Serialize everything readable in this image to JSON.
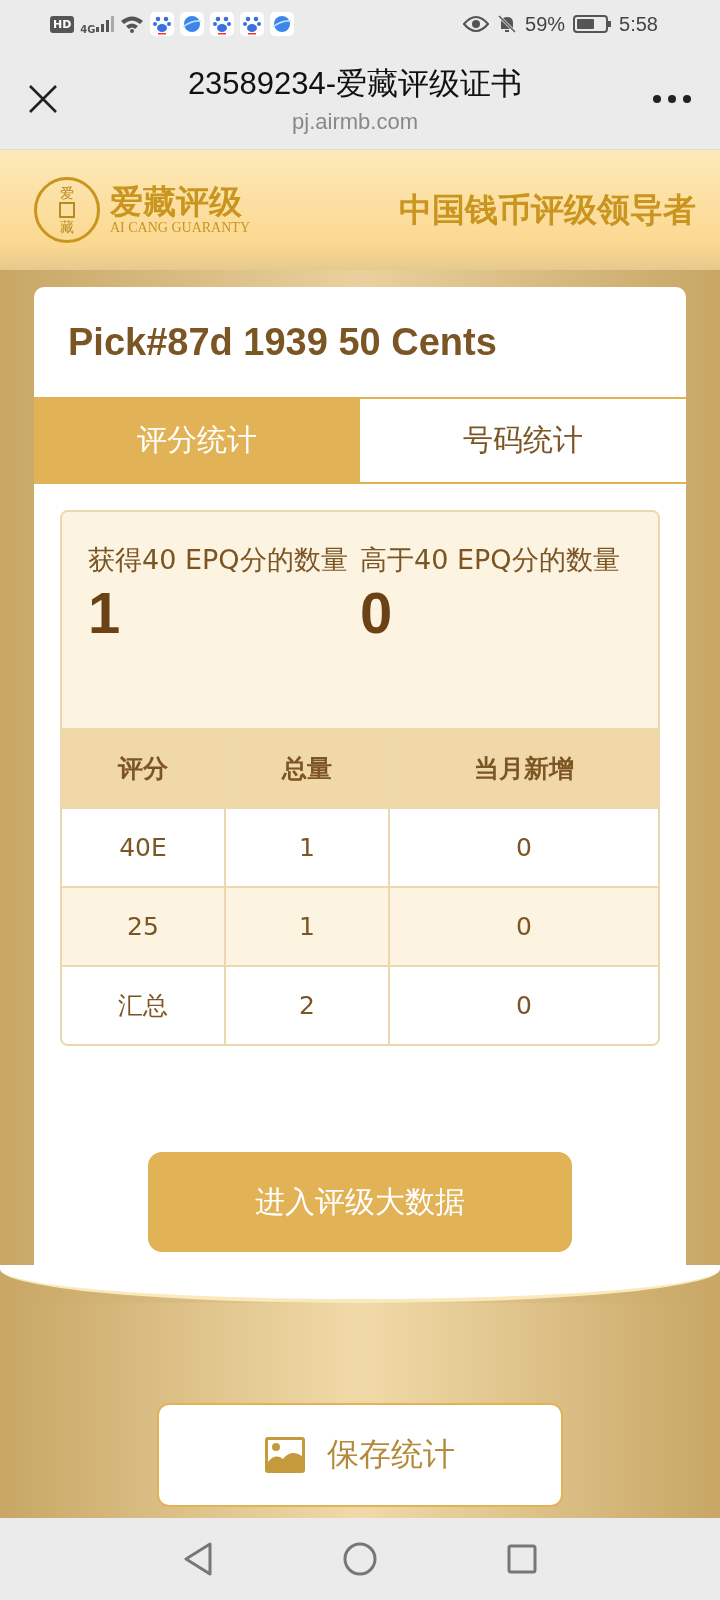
{
  "status_bar": {
    "hd": "HD",
    "network": "4G",
    "app_icons": [
      {
        "kind": "paw"
      },
      {
        "kind": "globe"
      },
      {
        "kind": "paw"
      },
      {
        "kind": "paw"
      },
      {
        "kind": "globe"
      }
    ],
    "battery": "59%",
    "time": "5:58"
  },
  "browser": {
    "title": "23589234-爱藏评级证书",
    "url": "pj.airmb.com"
  },
  "banner": {
    "coin_top": "爱",
    "coin_bottom": "藏",
    "brand": "爱藏评级",
    "brand_en": "AI CANG GUARANTY",
    "slogan": "中国钱币评级领导者"
  },
  "card": {
    "title": "Pick#87d 1939 50 Cents"
  },
  "tabs": [
    {
      "label": "评分统计",
      "selected": true
    },
    {
      "label": "号码统计",
      "selected": false
    }
  ],
  "stats": [
    {
      "label": "获得40 EPQ分的数量",
      "value": "1"
    },
    {
      "label": "高于40 EPQ分的数量",
      "value": "0"
    }
  ],
  "table": {
    "columns": [
      "评分",
      "总量",
      "当月新增"
    ],
    "rows": [
      {
        "cells": [
          "40E",
          "1",
          "0"
        ],
        "shaded": false
      },
      {
        "cells": [
          "25",
          "1",
          "0"
        ],
        "shaded": true
      },
      {
        "cells": [
          "汇总",
          "2",
          "0"
        ],
        "shaded": false
      }
    ]
  },
  "big_data_button": "进入评级大数据",
  "save_button": "保存统计"
}
